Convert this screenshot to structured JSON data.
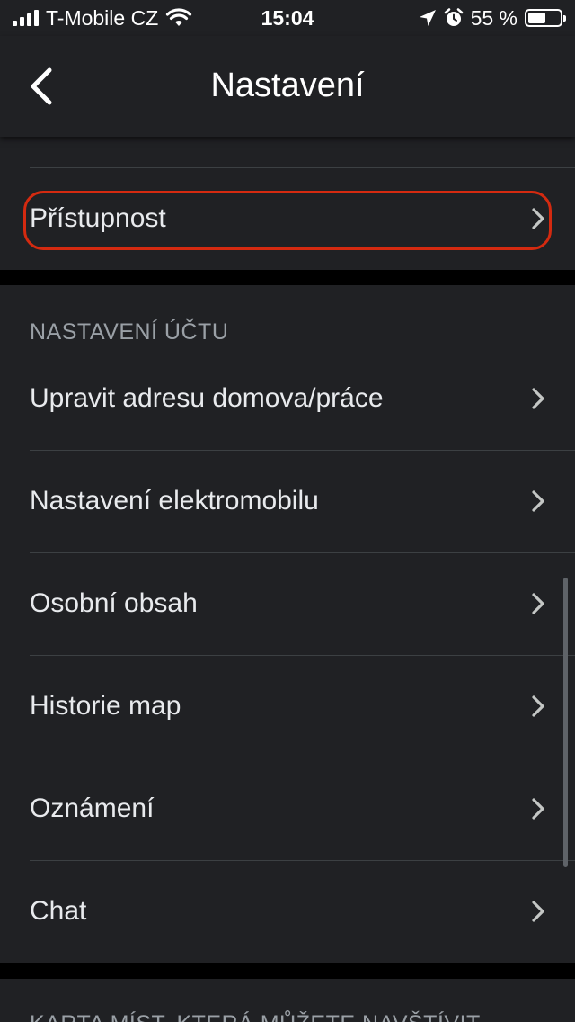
{
  "status_bar": {
    "carrier": "T-Mobile CZ",
    "time": "15:04",
    "battery_percent": "55 %",
    "battery_level": 0.55
  },
  "header": {
    "title": "Nastavení",
    "back_icon": "chevron-left-icon"
  },
  "top_section": {
    "items": [
      {
        "label": "Přístupnost",
        "highlighted": true
      }
    ]
  },
  "account_section": {
    "header": "NASTAVENÍ ÚČTU",
    "items": [
      {
        "label": "Upravit adresu domova/práce"
      },
      {
        "label": "Nastavení elektromobilu"
      },
      {
        "label": "Osobní obsah"
      },
      {
        "label": "Historie map"
      },
      {
        "label": "Oznámení"
      },
      {
        "label": "Chat"
      }
    ]
  },
  "bottom_section": {
    "header": "KARTA MÍST, KTERÁ MŮŽETE NAVŠTÍVIT"
  },
  "colors": {
    "background": "#202124",
    "separator_band": "#000000",
    "text_primary": "#e8eaed",
    "text_secondary": "#9aa0a6",
    "highlight_ring": "#d42a10"
  }
}
